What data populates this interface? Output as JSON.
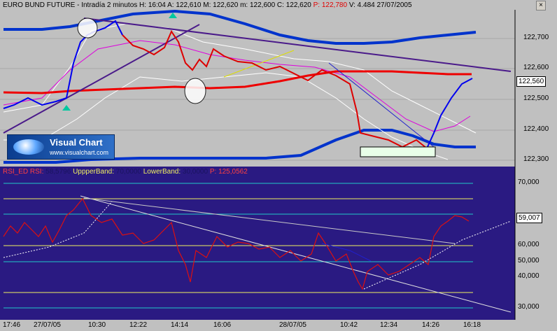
{
  "price_header": {
    "title": "EURO BUND FUTURE - Intradía 2 minutos",
    "h_label": "H:",
    "h_value": "16:04",
    "a_label": "A:",
    "a_value": "122,610",
    "m_label": "M:",
    "m_value": "122,620",
    "min_label": "m:",
    "min_value": "122,600",
    "c_label": "C:",
    "c_value": "122,620",
    "p_label": "P:",
    "p_value": "122,780",
    "v_label": "V:",
    "v_value": "4.484",
    "date": "27/07/2005"
  },
  "price_axis": {
    "ticks": [
      "122,700",
      "122,600",
      "122,500",
      "122,400",
      "122,300"
    ],
    "current_value": "122,560"
  },
  "logo": {
    "title": "Visual Chart",
    "url": "www.visualchart.com"
  },
  "rsi_header": {
    "name": "RSI_ED",
    "rsi_label": "RSI:",
    "rsi_value": "58,5796",
    "upper_label": "UppperBand:",
    "upper_value": "70,0000",
    "lower_label": "LowerBand:",
    "lower_value": "30,0000",
    "p_label": "P:",
    "p_value": "125,0562"
  },
  "rsi_axis": {
    "ticks": [
      "70,000",
      "60,000",
      "50,000",
      "40,000",
      "30,000"
    ],
    "current_value": "59,007"
  },
  "time_axis": {
    "labels": [
      "17:46",
      "27/07/05",
      "10:30",
      "12:22",
      "14:14",
      "16:06",
      "28/07/05",
      "10:42",
      "12:34",
      "14:26",
      "16:18"
    ]
  },
  "window": {
    "close_glyph": "×"
  },
  "colors": {
    "price_bg": "#c0c0c0",
    "rsi_bg": "#2a1a82",
    "price_line": "#0000ee",
    "down_line": "#dd0000",
    "ma": "#ee0000",
    "band": "#0033cc",
    "trendline": "#4a1a8a"
  }
}
